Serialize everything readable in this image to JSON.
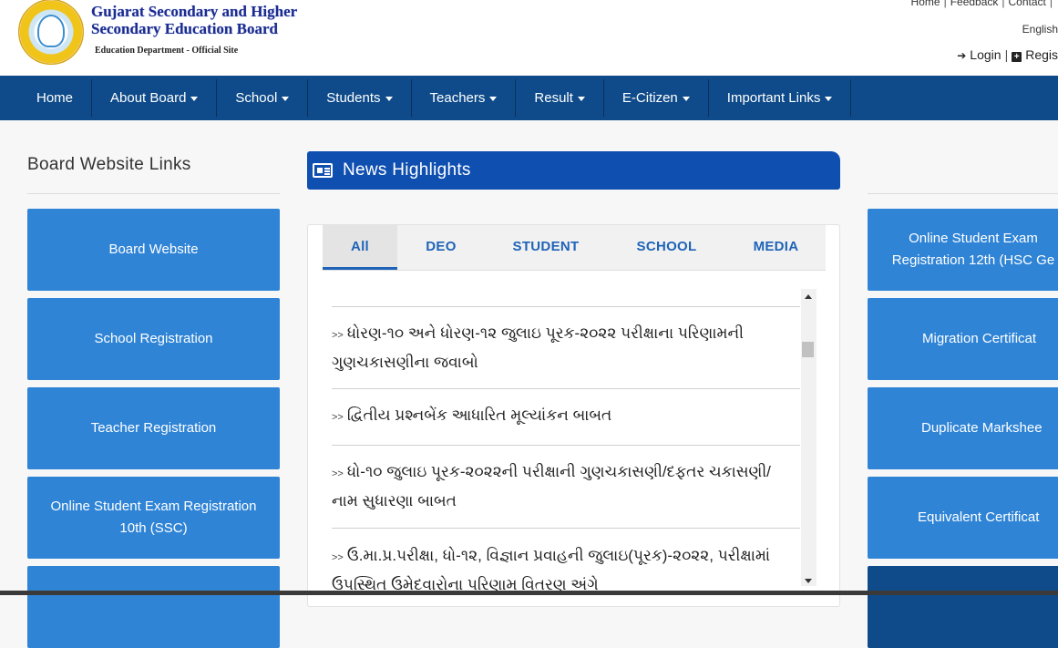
{
  "header": {
    "board_name_line1": "Gujarat Secondary and Higher",
    "board_name_line2": "Secondary Education Board",
    "board_sub": "Education Department - Official Site",
    "toplinks": [
      "Home",
      "Feedback",
      "Contact"
    ],
    "language": "English",
    "login": "Login",
    "register": "Regis"
  },
  "nav": {
    "items": [
      {
        "label": "Home",
        "dropdown": false
      },
      {
        "label": "About Board",
        "dropdown": true
      },
      {
        "label": "School",
        "dropdown": true
      },
      {
        "label": "Students",
        "dropdown": true
      },
      {
        "label": "Teachers",
        "dropdown": true
      },
      {
        "label": "Result",
        "dropdown": true
      },
      {
        "label": "E-Citizen",
        "dropdown": true
      },
      {
        "label": "Important Links",
        "dropdown": true
      }
    ]
  },
  "left": {
    "title": "Board Website Links",
    "links": [
      "Board Website",
      "School Registration",
      "Teacher Registration",
      "Online Student Exam Registration 10th (SSC)"
    ]
  },
  "right": {
    "links": [
      "Online Student Exam Registration 12th (HSC Ge",
      "Migration Certificat",
      "Duplicate Markshee",
      "Equivalent Certificat"
    ]
  },
  "news": {
    "title": "News Highlights",
    "tabs": [
      "All",
      "DEO",
      "STUDENT",
      "SCHOOL",
      "MEDIA"
    ],
    "active_tab": "All",
    "arrow": ">>",
    "items": [
      "ધોરણ-૧૦ અને ધોરણ-૧૨ જુલાઇ પૂરક-૨૦૨૨ પરીક્ષાના પરિણામની ગુણચકાસણીના જવાબો",
      "દ્વિતીય પ્રશ્નબેંક આધારિત મૂલ્યાંકન બાબત",
      "ધો-૧૦ જુલાઇ પૂરક-૨૦૨૨ની પરીક્ષાની ગુણચકાસણી/દફતર ચકાસણી/ નામ સુધારણા બાબત",
      "ઉ.મા.પ્ર.પરીક્ષા, ધો-૧૨, વિજ્ઞાન પ્રવાહની જુલાઇ(પૂરક)-૨૦૨૨, પરીક્ષામાં ઉપસ્થિત ઉમેદવારોના પરિણામ વિતરણ અંગે"
    ]
  },
  "colors": {
    "nav_bg": "#0f4b8a",
    "link_box": "#2f84d6",
    "news_head": "#0f4fb0",
    "tab_text": "#1f63b8"
  }
}
